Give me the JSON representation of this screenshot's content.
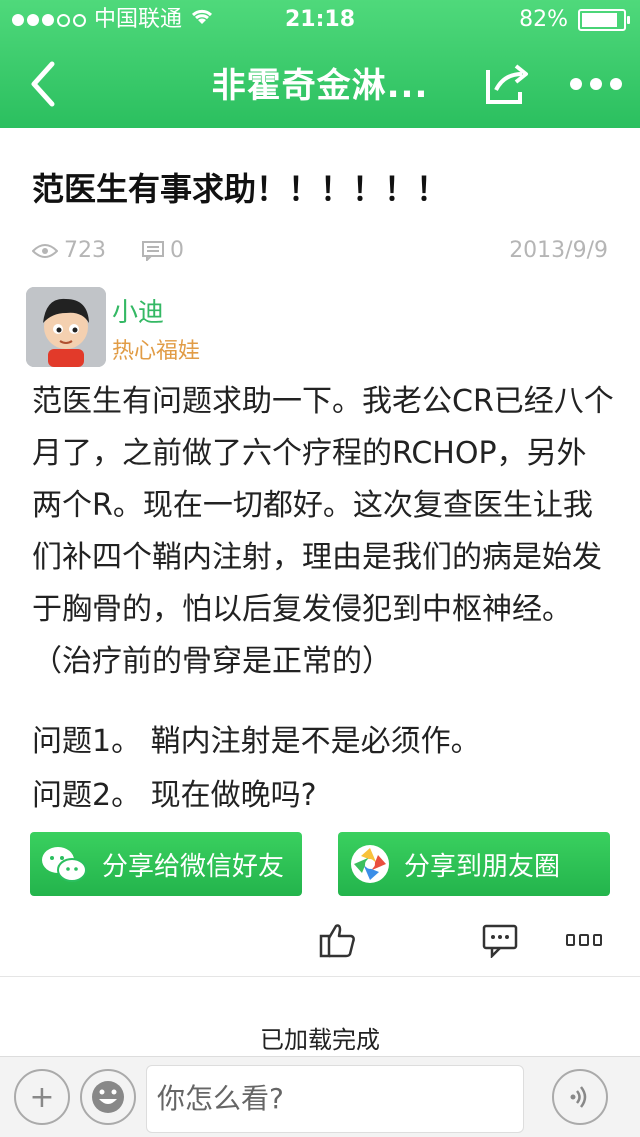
{
  "status": {
    "carrier": "中国联通",
    "time": "21:18",
    "battery": "82%"
  },
  "nav": {
    "title": "非霍奇金淋..."
  },
  "post": {
    "title": "范医生有事求助！！！！！！",
    "views": "723",
    "comments": "0",
    "date": "2013/9/9",
    "author": "小迪",
    "badge": "热心福娃",
    "body": "范医生有问题求助一下。我老公CR已经八个月了，之前做了六个疗程的RCHOP，另外两个R。现在一切都好。这次复查医生让我们补四个鞘内注射，理由是我们的病是始发于胸骨的，怕以后复发侵犯到中枢神经。（治疗前的骨穿是正常的）",
    "question1": "问题1。 鞘内注射是不是必须作。",
    "question2": "问题2。 现在做晚吗?"
  },
  "share": {
    "wechat": "分享给微信好友",
    "moments": "分享到朋友圈"
  },
  "footer": {
    "loaded": "已加载完成",
    "input_placeholder": "你怎么看?"
  },
  "colors": {
    "accent": "#2bbf5f",
    "author": "#34b864",
    "badge": "#e19c46"
  }
}
